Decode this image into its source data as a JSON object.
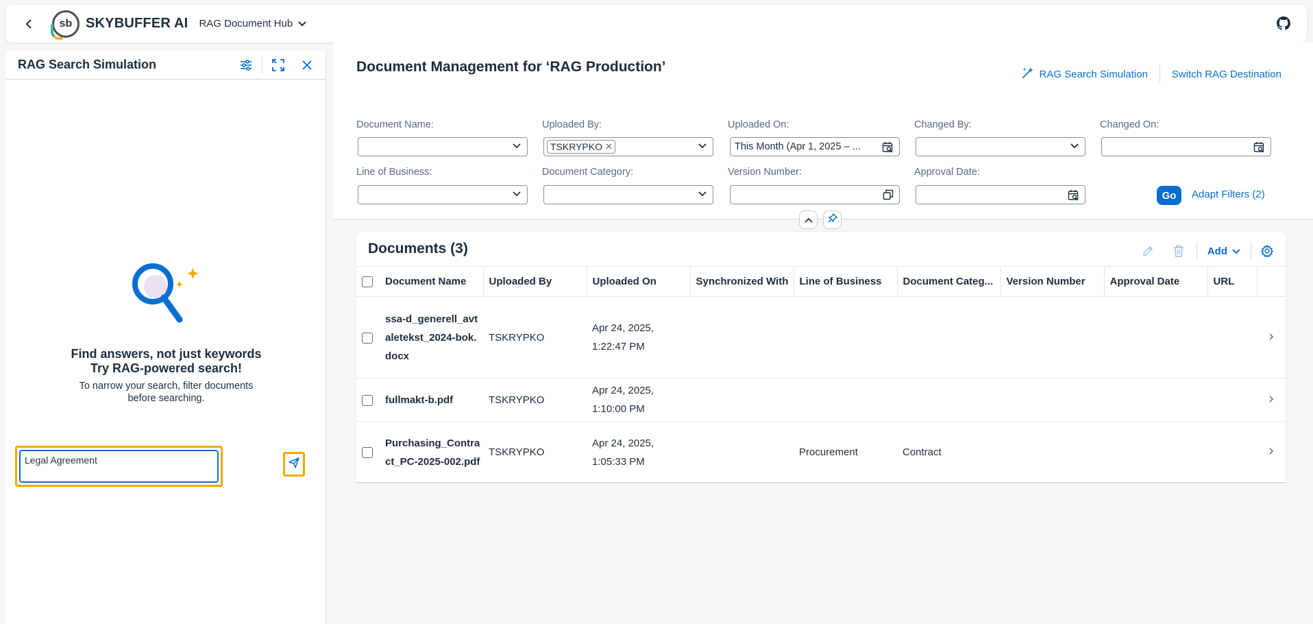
{
  "shell": {
    "brand": "SKYBUFFER AI",
    "logo_text": "sb",
    "app_title": "RAG Document Hub",
    "icons": [
      "back-icon",
      "chevron-down-icon",
      "github-icon"
    ]
  },
  "left_panel": {
    "title": "RAG Search Simulation",
    "icons": [
      "filter-settings-icon",
      "expand-icon",
      "close-icon"
    ],
    "headline_1": "Find answers, not just keywords",
    "headline_2": "Try RAG-powered search!",
    "hint": "To narrow your search, filter documents before searching.",
    "query_value": "Legal Agreement",
    "send_icon": "send-icon"
  },
  "main": {
    "title": "Document Management for ‘RAG Production’",
    "actions": {
      "rag_search": "RAG Search Simulation",
      "switch_destination": "Switch RAG Destination"
    },
    "filters": {
      "document_name": {
        "label": "Document Name:",
        "value": ""
      },
      "uploaded_by": {
        "label": "Uploaded By:",
        "token": "TSKRYPKO"
      },
      "uploaded_on": {
        "label": "Uploaded On:",
        "value": "This Month (Apr 1, 2025 – ..."
      },
      "changed_by": {
        "label": "Changed By:",
        "value": ""
      },
      "changed_on": {
        "label": "Changed On:",
        "value": ""
      },
      "line_of_business": {
        "label": "Line of Business:",
        "value": ""
      },
      "document_category": {
        "label": "Document Category:",
        "value": ""
      },
      "version_number": {
        "label": "Version Number:",
        "value": ""
      },
      "approval_date": {
        "label": "Approval Date:",
        "value": ""
      },
      "go_label": "Go",
      "adapt_label": "Adapt Filters (2)"
    }
  },
  "documents": {
    "title": "Documents (3)",
    "add_label": "Add",
    "columns": [
      "Document Name",
      "Uploaded By",
      "Uploaded On",
      "Synchronized With",
      "Line of Business",
      "Document Categ...",
      "Version Number",
      "Approval Date",
      "URL"
    ],
    "rows": [
      {
        "name": "ssa-d_generell_avtaletekst_2024-bok.docx",
        "uploaded_by": "TSKRYPKO",
        "uploaded_on_1": "Apr 24, 2025,",
        "uploaded_on_2": "1:22:47 PM",
        "synced": "",
        "lob": "",
        "category": "",
        "version": "",
        "approval": "",
        "url": ""
      },
      {
        "name": "fullmakt-b.pdf",
        "uploaded_by": "TSKRYPKO",
        "uploaded_on_1": "Apr 24, 2025,",
        "uploaded_on_2": "1:10:00 PM",
        "synced": "",
        "lob": "",
        "category": "",
        "version": "",
        "approval": "",
        "url": ""
      },
      {
        "name": "Purchasing_Contract_PC-2025-002.pdf",
        "uploaded_by": "TSKRYPKO",
        "uploaded_on_1": "Apr 24, 2025,",
        "uploaded_on_2": "1:05:33 PM",
        "synced": "",
        "lob": "Procurement",
        "category": "Contract",
        "version": "",
        "approval": "",
        "url": ""
      }
    ]
  },
  "colors": {
    "accent": "#0a6ed1",
    "highlight": "#f0ab00",
    "text": "#1d2d3e",
    "label": "#556b82"
  }
}
